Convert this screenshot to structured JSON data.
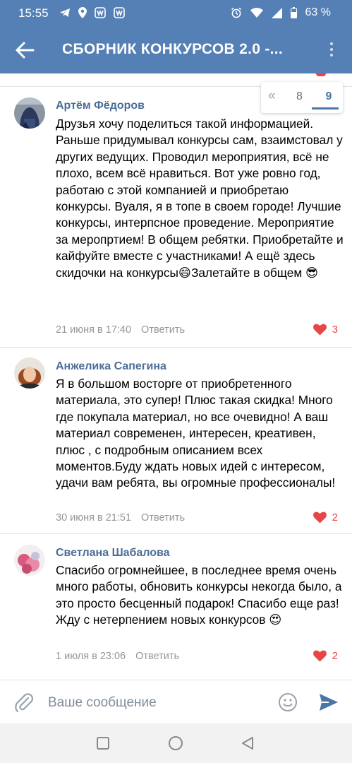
{
  "status_bar": {
    "time": "15:55",
    "battery": "63 %",
    "icons": [
      "telegram-icon",
      "location-icon",
      "vk-icon",
      "vk-icon",
      "alarm-icon",
      "wifi-icon",
      "signal-icon",
      "battery-icon"
    ]
  },
  "header": {
    "title": "СБОРНИК КОНКУРСОВ 2.0 -...",
    "back_icon": "arrow-left-icon",
    "menu_icon": "more-vertical-icon"
  },
  "pager": {
    "prev": "«",
    "pages": [
      "8",
      "9"
    ],
    "current": "9"
  },
  "comments": [
    {
      "author": "Артём Фёдоров",
      "text": "Друзья хочу поделиться такой информацией. Раньше придумывал конкурсы сам, взаимстовал у других ведущих. Проводил мероприятия, всё не плохо, всем всё нравиться. Вот уже ровно год, работаю с этой компанией и приобретаю конкурсы. Вуаля, я в топе в своем городе! Лучшие конкурсы, интерпсное проведение. Мероприятие за меропртием! В общем ребятки. Приобретайте и кайфуйте вместе с участниками! А ещё здесь скидочки на конкурсы😄Залетайте в общем 😎",
      "date": "21 июня в 17:40",
      "reply": "Ответить",
      "likes": "3"
    },
    {
      "author": "Анжелика Сапегина",
      "text": "Я в большом восторге от приобретенного материала, это супер! Плюс такая скидка! Много где покупала материал, но все очевидно! А ваш материал современен, интересен, креативен, плюс , с подробным описанием всех моментов.Буду ждать новых идей с интересом, удачи вам ребята, вы огромные профессионалы!",
      "date": "30 июня в 21:51",
      "reply": "Ответить",
      "likes": "2"
    },
    {
      "author": "Светлана Шабалова",
      "text": "Спасибо огромнейшее, в последнее время очень много работы, обновить конкурсы некогда было, а это просто бесценный подарок! Спасибо еще раз! Жду с нетерпением новых конкурсов 😍",
      "date": "1 июля в 23:06",
      "reply": "Ответить",
      "likes": "2"
    }
  ],
  "composer": {
    "placeholder": "Ваше сообщение",
    "attach_icon": "paperclip-icon",
    "emoji_icon": "smile-icon",
    "send_icon": "send-icon"
  },
  "colors": {
    "header": "#5580b5",
    "accent": "#4a76a8",
    "like": "#e64646",
    "meta": "#939699"
  }
}
